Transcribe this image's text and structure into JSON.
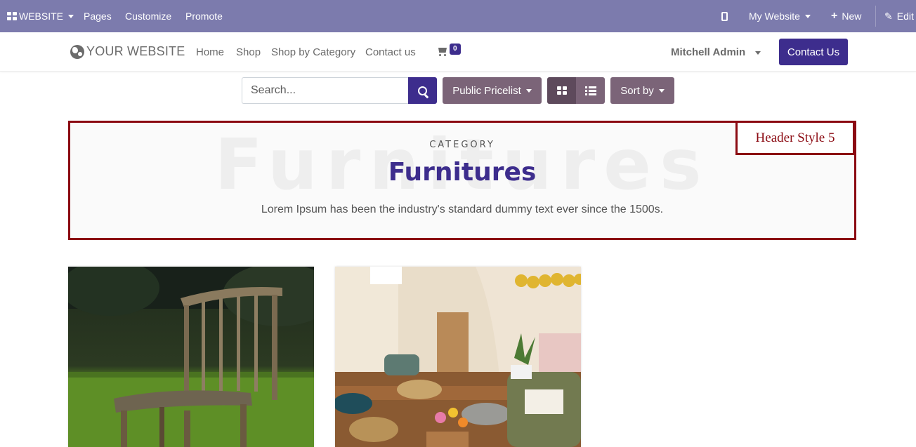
{
  "admin_bar": {
    "website_label": "WEBSITE",
    "menu": [
      "Pages",
      "Customize",
      "Promote"
    ],
    "site_selector": "My Website",
    "new_label": "New",
    "edit_label": "Edit"
  },
  "site": {
    "logo_text": "YOUR WEBSITE",
    "nav": [
      "Home",
      "Shop",
      "Shop by Category",
      "Contact us"
    ],
    "cart_count": "0",
    "user_name": "Mitchell Admin",
    "contact_button": "Contact Us"
  },
  "toolbar": {
    "search_placeholder": "Search...",
    "pricelist_label": "Public Pricelist",
    "sort_label": "Sort by",
    "active_view": "grid"
  },
  "category_header": {
    "watermark": "Furnitures",
    "label": "CATEGORY",
    "title": "Furnitures",
    "description": "Lorem Ipsum has been the industry's standard dummy text ever since the 1500s.",
    "style_tag": "Header Style 5",
    "border_color": "#8b0a12"
  },
  "products": [
    {
      "image": "wooden-chair-on-grass"
    },
    {
      "image": "living-room-interior"
    }
  ],
  "colors": {
    "admin_bar": "#7c7bad",
    "primary": "#3d2d8d",
    "secondary": "#7b6478"
  }
}
